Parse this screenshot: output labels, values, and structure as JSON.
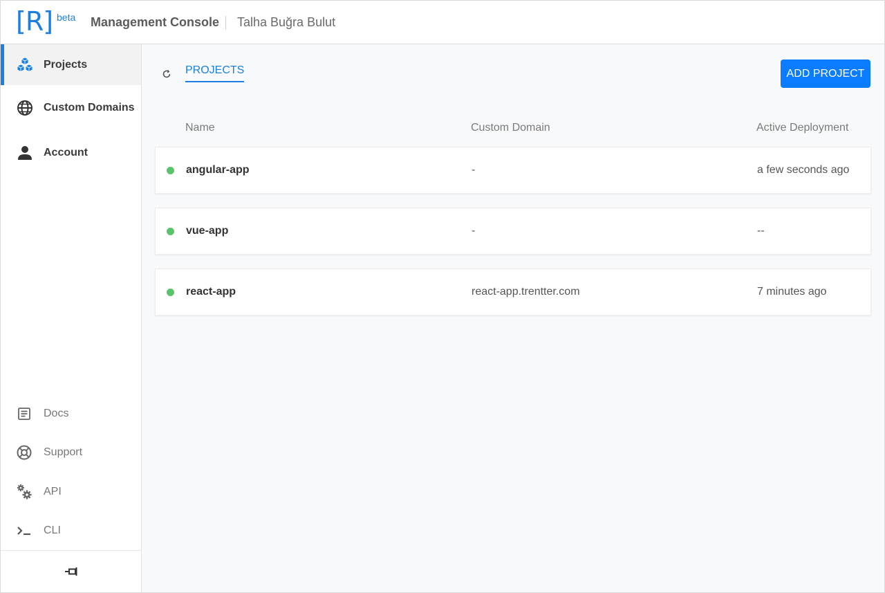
{
  "header": {
    "logo": "[R]",
    "beta": "beta",
    "title": "Management Console",
    "user": "Talha Buğra Bulut"
  },
  "sidebar": {
    "items": [
      {
        "label": "Projects",
        "icon": "cubes-icon",
        "active": true
      },
      {
        "label": "Custom Domains",
        "icon": "globe-icon"
      },
      {
        "label": "Account",
        "icon": "user-icon"
      }
    ],
    "footer_items": [
      {
        "label": "Docs",
        "icon": "document-icon"
      },
      {
        "label": "Support",
        "icon": "lifebuoy-icon"
      },
      {
        "label": "API",
        "icon": "gears-icon"
      },
      {
        "label": "CLI",
        "icon": "terminal-icon"
      }
    ],
    "pin_icon": "pin-icon"
  },
  "main": {
    "tab": "PROJECTS",
    "add_button": "ADD PROJECT",
    "columns": [
      "Name",
      "Custom Domain",
      "Active Deployment"
    ],
    "projects": [
      {
        "name": "angular-app",
        "domain": "-",
        "deployment": "a few seconds ago",
        "status": "green"
      },
      {
        "name": "vue-app",
        "domain": "-",
        "deployment": "--",
        "status": "green"
      },
      {
        "name": "react-app",
        "domain": "react-app.trentter.com",
        "deployment": "7 minutes ago",
        "status": "green"
      }
    ]
  },
  "colors": {
    "accent": "#1a7fe0",
    "button": "#0a7cff",
    "status_active": "#5ac46a"
  }
}
